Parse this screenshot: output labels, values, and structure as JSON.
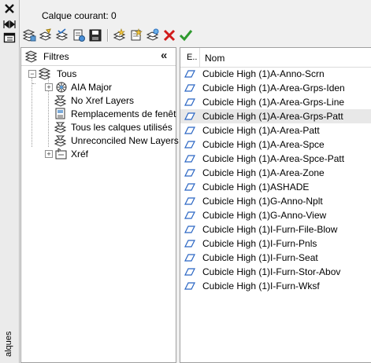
{
  "palette": {
    "title": "alques"
  },
  "header": {
    "current_layer": "Calque courant: 0"
  },
  "toolbar": {
    "buttons": [
      {
        "name": "new-property-filter-button",
        "icon": "filter-new-icon"
      },
      {
        "name": "new-group-filter-button",
        "icon": "group-filter-icon"
      },
      {
        "name": "layer-states-manager-button",
        "icon": "layer-states-icon"
      },
      {
        "name": "save-state-button",
        "icon": "save-icon"
      },
      {
        "name": "new-layer-button",
        "icon": "new-layer-icon"
      },
      {
        "name": "new-layer-vp-frozen-button",
        "icon": "new-layer-frozen-icon"
      },
      {
        "name": "delete-layer-button",
        "icon": "delete-icon"
      },
      {
        "name": "set-current-button",
        "icon": "checkmark-icon"
      }
    ]
  },
  "filters": {
    "title": "Filtres",
    "tree": [
      {
        "label": "Tous",
        "level": 0,
        "toggle": "−"
      },
      {
        "label": "AIA Major",
        "level": 1,
        "toggle": "+"
      },
      {
        "label": "No Xref Layers",
        "level": 1,
        "toggle": ""
      },
      {
        "label": "Remplacements de fenêt",
        "level": 1,
        "toggle": ""
      },
      {
        "label": "Tous les calques utilisés",
        "level": 1,
        "toggle": ""
      },
      {
        "label": "Unreconciled New Layers",
        "level": 1,
        "toggle": ""
      },
      {
        "label": "Xréf",
        "level": 1,
        "toggle": "+"
      }
    ]
  },
  "list": {
    "columns": {
      "status": "E..",
      "name": "Nom"
    },
    "rows": [
      "Cubicle High (1)A-Anno-Scrn",
      "Cubicle High (1)A-Area-Grps-Iden",
      "Cubicle High (1)A-Area-Grps-Line",
      "Cubicle High (1)A-Area-Grps-Patt",
      "Cubicle High (1)A-Area-Patt",
      "Cubicle High (1)A-Area-Spce",
      "Cubicle High (1)A-Area-Spce-Patt",
      "Cubicle High (1)A-Area-Zone",
      "Cubicle High (1)ASHADE",
      "Cubicle High (1)G-Anno-Nplt",
      "Cubicle High (1)G-Anno-View",
      "Cubicle High (1)I-Furn-File-Blow",
      "Cubicle High (1)I-Furn-Pnls",
      "Cubicle High (1)I-Furn-Seat",
      "Cubicle High (1)I-Furn-Stor-Abov",
      "Cubicle High (1)I-Furn-Wksf"
    ],
    "selected_index": 3
  }
}
